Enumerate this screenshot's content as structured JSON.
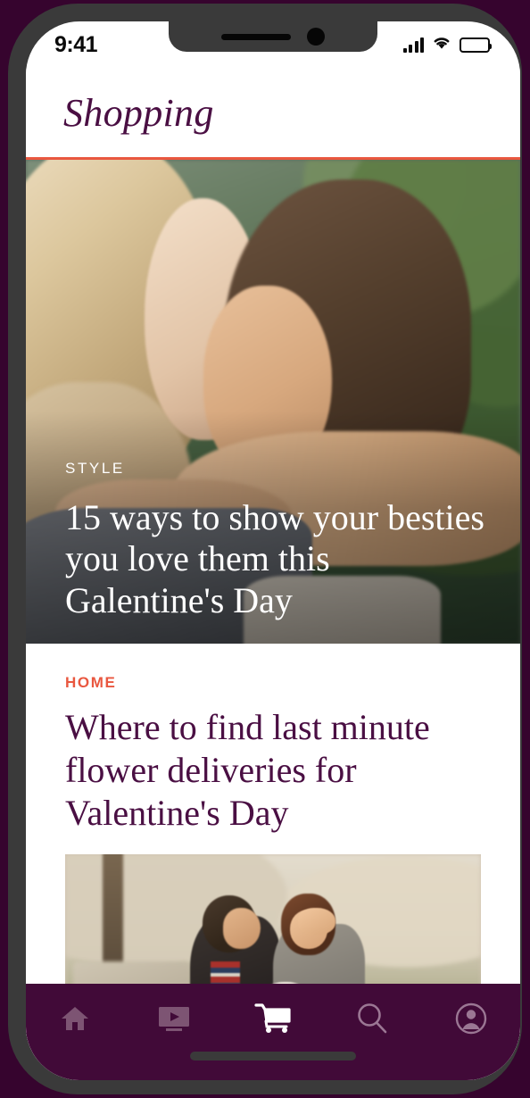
{
  "status_bar": {
    "time": "9:41",
    "signal_icon": "cellular-signal-icon",
    "wifi_icon": "wifi-icon",
    "battery_icon": "battery-full-icon"
  },
  "header": {
    "title": "Shopping",
    "title_color": "#4a0f43"
  },
  "theme": {
    "accent_rule_color": "#e9573f",
    "kicker_red": "#e9573f",
    "nav_bar_color": "#410a38",
    "nav_icon_inactive": "#7d5473",
    "nav_icon_active": "#ffffff",
    "frame_color": "#3a3a3a",
    "page_background": "#36042e"
  },
  "feed": {
    "hero": {
      "kicker": "STYLE",
      "headline": "15 ways to show your besties you love them this Galentine's Day",
      "image_alt": "two-women-embracing-outdoors"
    },
    "article": {
      "kicker": "HOME",
      "headline": "Where to find last minute flower deliveries for Valentine's Day",
      "image_alt": "man-surprising-woman-with-flowers-in-park"
    }
  },
  "bottom_nav": {
    "items": [
      {
        "name": "home",
        "icon": "home-icon",
        "label": "Home",
        "active": false
      },
      {
        "name": "video",
        "icon": "video-icon",
        "label": "Video",
        "active": false
      },
      {
        "name": "cart",
        "icon": "cart-icon",
        "label": "Cart",
        "active": true
      },
      {
        "name": "search",
        "icon": "search-icon",
        "label": "Search",
        "active": false
      },
      {
        "name": "profile",
        "icon": "profile-icon",
        "label": "Profile",
        "active": false
      }
    ]
  },
  "home_indicator": "home-indicator-bar"
}
